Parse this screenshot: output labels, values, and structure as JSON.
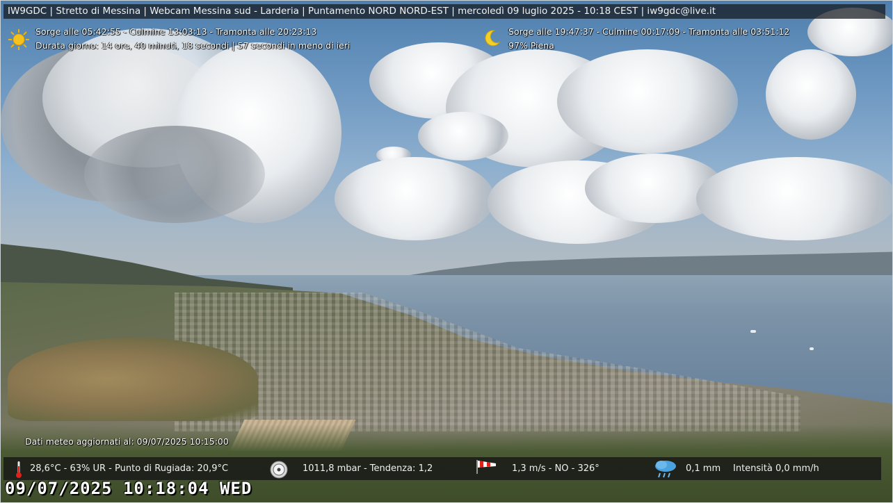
{
  "header": {
    "text": "IW9GDC | Stretto di Messina | Webcam Messina sud - Larderia | Puntamento NORD NORD-EST | mercoledì 09 luglio 2025 - 10:18 CEST | iw9gdc@live.it"
  },
  "sun": {
    "icon": "sun-icon",
    "line1": "Sorge alle 05:42:55 - Culmine 13:03:13 - Tramonta alle 20:23:13",
    "line2": "Durata giorno: 14 ore, 40 minuti, 18 secondi | 57 secondi in meno di ieri"
  },
  "moon": {
    "icon": "moon-icon",
    "line1": "Sorge alle 19:47:37 - Culmine 00:17:09 - Tramonta alle 03:51:12",
    "line2": "97%  Piena"
  },
  "meteo_update": "Dati meteo aggiornati al: 09/07/2025 10:15:00",
  "weather": {
    "temperature": "28,6°C  -  63% UR  -  Punto di Rugiada: 20,9°C",
    "pressure": "1011,8 mbar  -  Tendenza: 1,2",
    "wind": "1,3 m/s  -  NO  -  326°",
    "rain": "0,1 mm",
    "rain_intensity": "Intensità 0,0 mm/h"
  },
  "timestamp": "09/07/2025 10:18:04 WED",
  "colors": {
    "overlay_bar": "#14181c",
    "text": "#ffffff",
    "sky": "#6c97c1",
    "sea": "#7b92a7"
  }
}
